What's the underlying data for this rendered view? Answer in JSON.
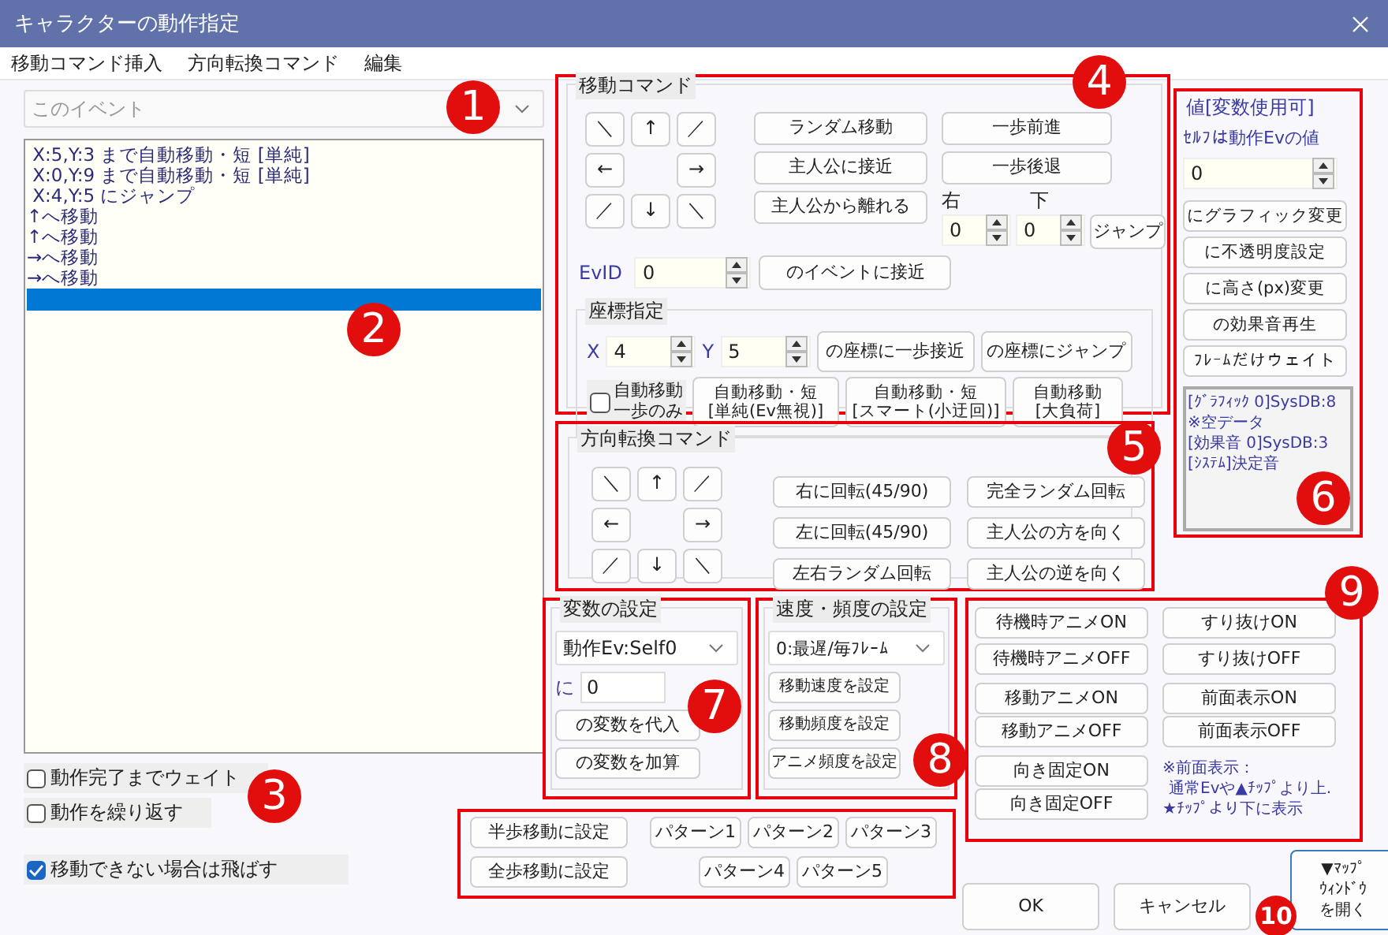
{
  "window": {
    "title": "キャラクターの動作指定"
  },
  "menu": [
    "移動コマンド挿入",
    "方向転換コマンド",
    "編集"
  ],
  "target_select": {
    "value": "このイベント",
    "disabled": true,
    "callout": "1"
  },
  "command_list": {
    "callout": "2",
    "items": [
      {
        "text": " X:5,Y:3 まで自動移動・短 [単純]",
        "selected": false
      },
      {
        "text": " X:0,Y:9 まで自動移動・短 [単純]",
        "selected": false
      },
      {
        "text": " X:4,Y:5 にジャンプ",
        "selected": false
      },
      {
        "text": "↑へ移動",
        "selected": false
      },
      {
        "text": "↑へ移動",
        "selected": false
      },
      {
        "text": "→へ移動",
        "selected": false
      },
      {
        "text": "→へ移動",
        "selected": false
      }
    ],
    "end_row": {
      "selected": true
    }
  },
  "options": {
    "callout": "3",
    "checkboxes": [
      {
        "label": "動作完了までウェイト",
        "checked": false
      },
      {
        "label": "動作を繰り返す",
        "checked": false
      },
      {
        "label": "移動できない場合は飛ばす",
        "checked": true
      }
    ]
  },
  "move_commands": {
    "title": "移動コマンド",
    "callout": "4",
    "outlined": true,
    "arrows": [
      "＼",
      "↑",
      "／",
      "←",
      "→",
      "／",
      "↓",
      "＼"
    ],
    "buttons": [
      "ランダム移動",
      "主人公に接近",
      "主人公から離れる"
    ],
    "step_buttons": [
      "一歩前進",
      "一歩後退"
    ],
    "jump": {
      "right_label": "右",
      "right_value": "0",
      "down_label": "下",
      "down_value": "0",
      "button": "ジャンプ"
    },
    "event": {
      "label": "EvID",
      "value": "0",
      "button": "のイベントに接近"
    },
    "coords": {
      "title": "座標指定",
      "x_label": "X",
      "x_value": "4",
      "y_label": "Y",
      "y_value": "5",
      "buttons": [
        "の座標に一歩接近",
        "の座標にジャンプ"
      ],
      "one_step": {
        "label_lines": [
          "自動移動",
          "一歩のみ"
        ],
        "checked": false
      },
      "auto_buttons": [
        "自動移動・短\n[単純(Ev無視)]",
        "自動移動・短\n[スマート(小迂回)]",
        "自動移動\n[大負荷]"
      ]
    }
  },
  "value_panel": {
    "title": "値[変数使用可]",
    "note": "ｾﾙﾌは動作Evの値",
    "value": "0",
    "callout": "6",
    "outlined": true,
    "buttons": [
      "にグラフィック変更",
      "に不透明度設定",
      "に高さ(px)変更",
      "の効果音再生",
      "ﾌﾚｰﾑだけウェイト"
    ],
    "info": [
      "[ｸﾞﾗﾌｨｯｸ 0]SysDB:8",
      "※空データ",
      "[効果音 0]SysDB:3",
      "[ｼｽﾃﾑ]決定音"
    ]
  },
  "direction_commands": {
    "title": "方向転換コマンド",
    "callout": "5",
    "outlined": true,
    "arrows": [
      "＼",
      "↑",
      "／",
      "←",
      "→",
      "／",
      "↓",
      "＼"
    ],
    "buttons": [
      "右に回転(45/90)",
      "完全ランダム回転",
      "左に回転(45/90)",
      "主人公の方を向く",
      "左右ランダム回転",
      "主人公の逆を向く"
    ]
  },
  "variable": {
    "title": "変数の設定",
    "callout": "7",
    "outlined": true,
    "select": "動作Ev:Self0",
    "label": "に",
    "value": "0",
    "buttons": [
      "の変数を代入",
      "の変数を加算"
    ]
  },
  "speed": {
    "title": "速度・頻度の設定",
    "callout": "8",
    "outlined": true,
    "select": "0:最遅/毎ﾌﾚｰﾑ",
    "buttons": [
      "移動速度を設定",
      "移動頻度を設定",
      "アニメ頻度を設定"
    ]
  },
  "toggles": {
    "callout": "9",
    "outlined": true,
    "buttons": [
      [
        "待機時アニメON",
        "すり抜けON"
      ],
      [
        "待機時アニメOFF",
        "すり抜けOFF"
      ],
      [
        "移動アニメON",
        "前面表示ON"
      ],
      [
        "移動アニメOFF",
        "前面表示OFF"
      ],
      [
        "向き固定ON"
      ],
      [
        "向き固定OFF"
      ]
    ],
    "note_lines": [
      "※前面表示：",
      "通常Evや▲ﾁｯﾌﾟより上.",
      "★ﾁｯﾌﾟより下に表示"
    ]
  },
  "patterns": {
    "outlined": true,
    "step_buttons": [
      "半歩移動に設定",
      "全歩移動に設定"
    ],
    "buttons": [
      "パターン1",
      "パターン2",
      "パターン3",
      "パターン4",
      "パターン5"
    ]
  },
  "footer": {
    "ok": "OK",
    "cancel": "キャンセル",
    "map_button_lines": [
      "▼ﾏｯﾌﾟ",
      "ｳｨﾝﾄﾞｳ",
      "を開く"
    ],
    "callout": "10"
  }
}
